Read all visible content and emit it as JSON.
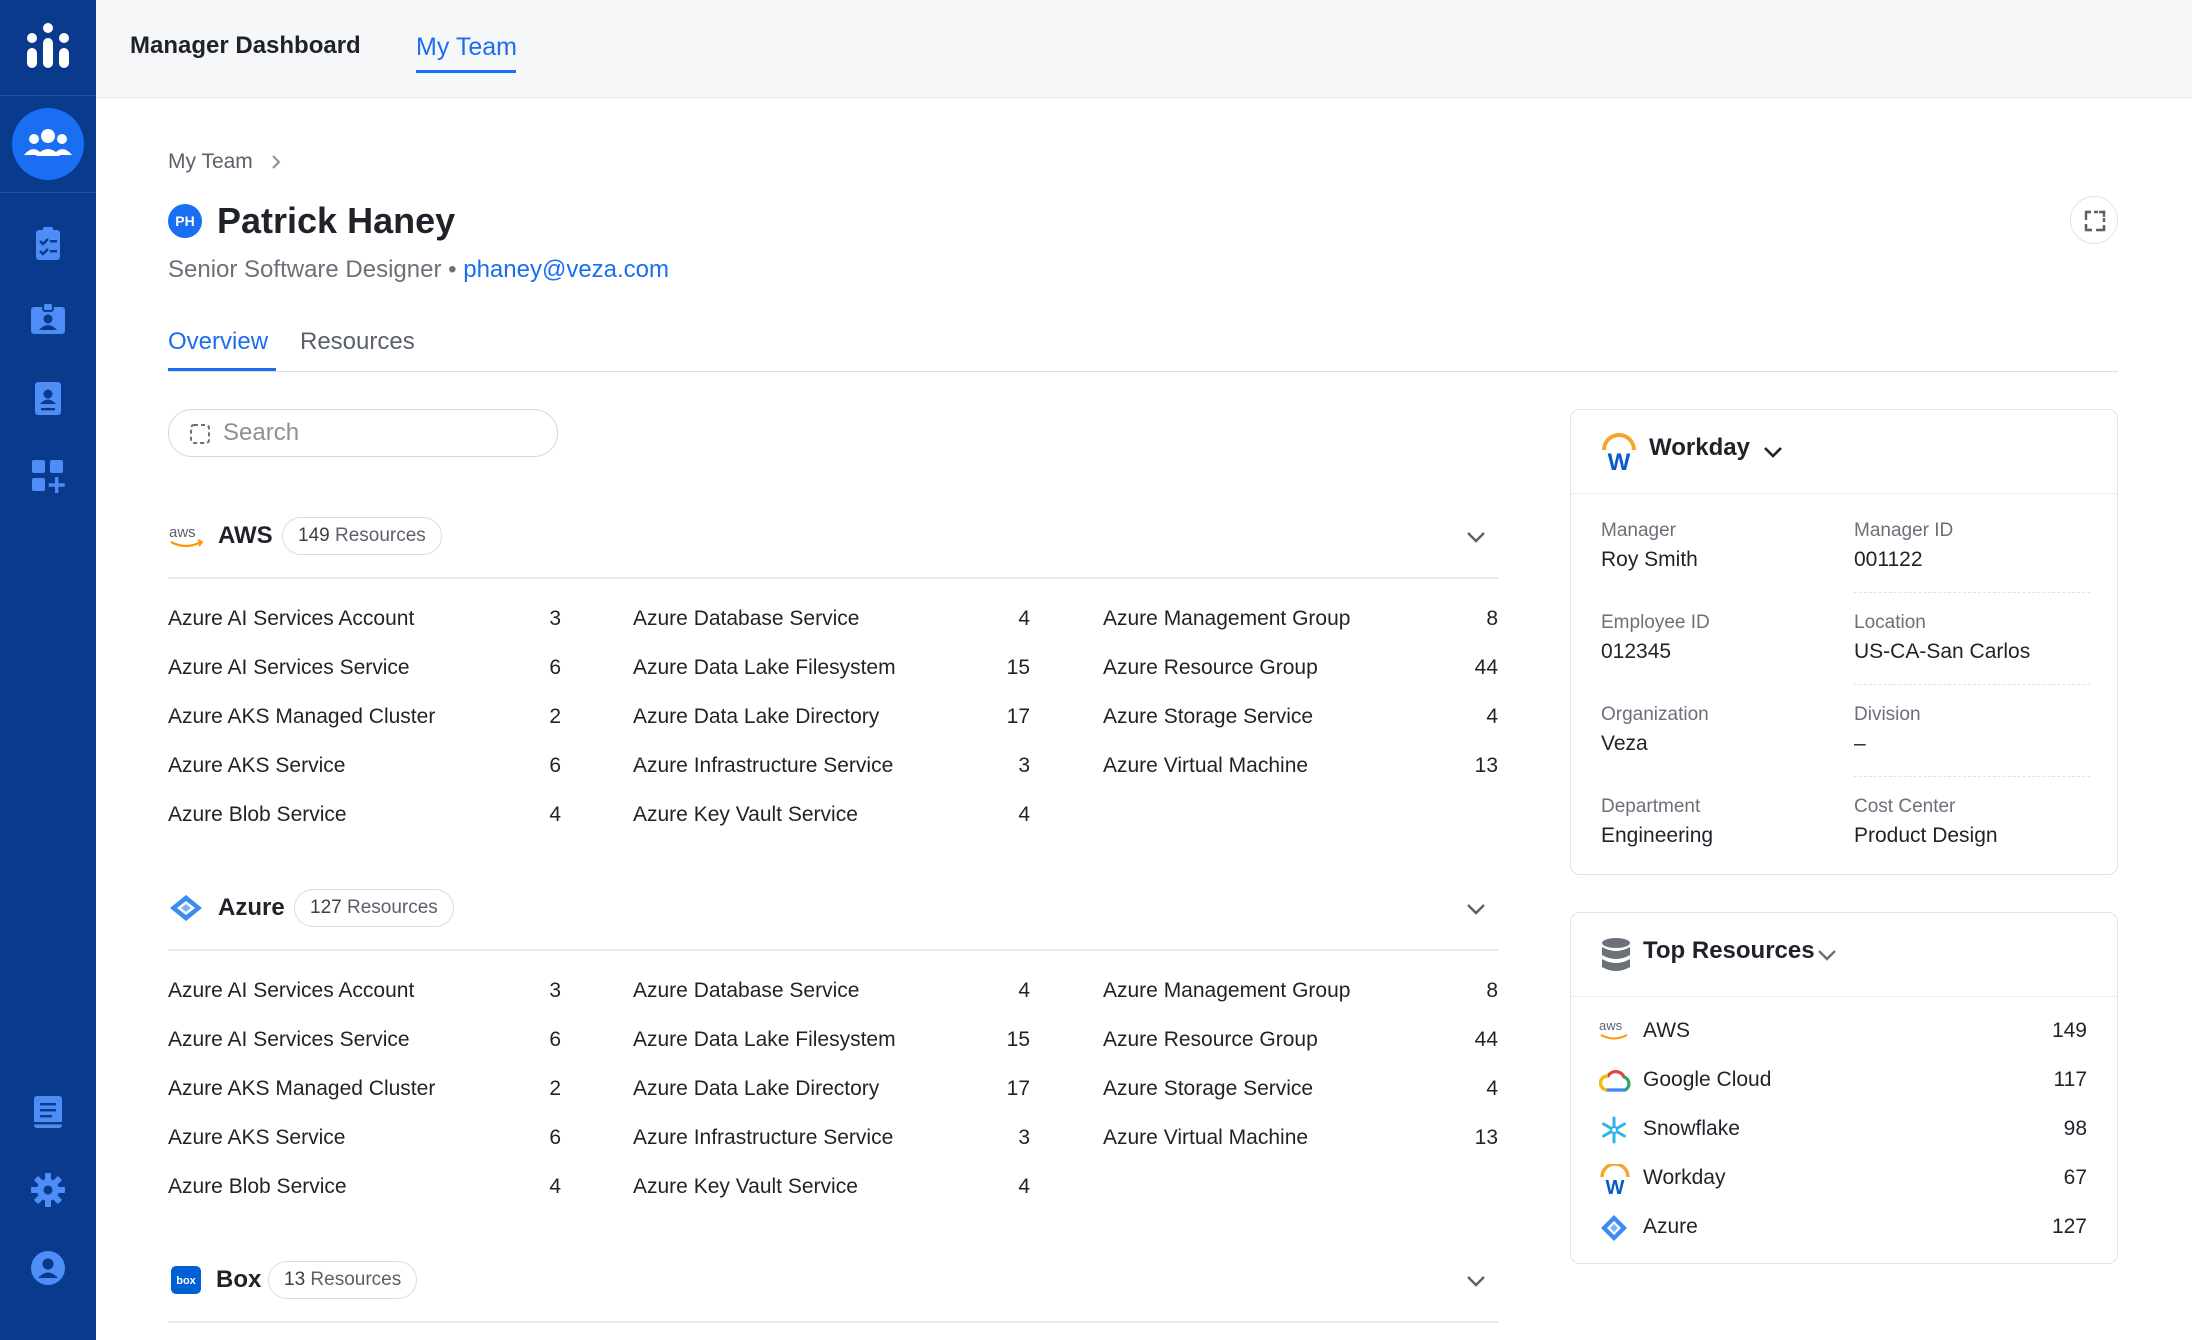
{
  "app": {
    "title": "Manager Dashboard",
    "nav_tab": "My Team"
  },
  "breadcrumb": {
    "item": "My Team"
  },
  "person": {
    "initials": "PH",
    "name": "Patrick Haney",
    "title": "Senior Software Designer",
    "separator": "•",
    "email": "phaney@veza.com"
  },
  "tabs": {
    "overview": "Overview",
    "resources": "Resources"
  },
  "search": {
    "placeholder": "Search"
  },
  "groups": {
    "aws": {
      "logo": "aws-logo",
      "name": "AWS",
      "count": "149",
      "unit": "Resources",
      "items": [
        {
          "name": "Azure AI Services Account",
          "value": "3"
        },
        {
          "name": "Azure AI Services Service",
          "value": "6"
        },
        {
          "name": "Azure AKS Managed Cluster",
          "value": "2"
        },
        {
          "name": "Azure AKS Service",
          "value": "6"
        },
        {
          "name": "Azure Blob Service",
          "value": "4"
        },
        {
          "name": "Azure Database Service",
          "value": "4"
        },
        {
          "name": "Azure Data Lake Filesystem",
          "value": "15"
        },
        {
          "name": "Azure Data Lake Directory",
          "value": "17"
        },
        {
          "name": "Azure Infrastructure Service",
          "value": "3"
        },
        {
          "name": "Azure Key Vault Service",
          "value": "4"
        },
        {
          "name": "Azure Management Group",
          "value": "8"
        },
        {
          "name": "Azure Resource Group",
          "value": "44"
        },
        {
          "name": "Azure Storage Service",
          "value": "4"
        },
        {
          "name": "Azure Virtual Machine",
          "value": "13"
        }
      ]
    },
    "azure": {
      "logo": "azure-logo",
      "name": "Azure",
      "count": "127",
      "unit": "Resources",
      "items": [
        {
          "name": "Azure AI Services Account",
          "value": "3"
        },
        {
          "name": "Azure AI Services Service",
          "value": "6"
        },
        {
          "name": "Azure AKS Managed Cluster",
          "value": "2"
        },
        {
          "name": "Azure AKS Service",
          "value": "6"
        },
        {
          "name": "Azure Blob Service",
          "value": "4"
        },
        {
          "name": "Azure Database Service",
          "value": "4"
        },
        {
          "name": "Azure Data Lake Filesystem",
          "value": "15"
        },
        {
          "name": "Azure Data Lake Directory",
          "value": "17"
        },
        {
          "name": "Azure Infrastructure Service",
          "value": "3"
        },
        {
          "name": "Azure Key Vault Service",
          "value": "4"
        },
        {
          "name": "Azure Management Group",
          "value": "8"
        },
        {
          "name": "Azure Resource Group",
          "value": "44"
        },
        {
          "name": "Azure Storage Service",
          "value": "4"
        },
        {
          "name": "Azure Virtual Machine",
          "value": "13"
        }
      ]
    },
    "box": {
      "logo": "box-logo",
      "logo_text": "box",
      "name": "Box",
      "count": "13",
      "unit": "Resources"
    }
  },
  "workday_card": {
    "logo": "workday-logo",
    "logo_text": "W",
    "title": "Workday",
    "fields": [
      {
        "label": "Manager",
        "value": "Roy Smith"
      },
      {
        "label": "Manager ID",
        "value": "001122"
      },
      {
        "label": "Employee ID",
        "value": "012345"
      },
      {
        "label": "Location",
        "value": "US-CA-San Carlos"
      },
      {
        "label": "Organization",
        "value": "Veza"
      },
      {
        "label": "Division",
        "value": "–"
      },
      {
        "label": "Department",
        "value": "Engineering"
      },
      {
        "label": "Cost Center",
        "value": "Product Design"
      }
    ]
  },
  "top_resources": {
    "title": "Top Resources",
    "items": [
      {
        "icon": "aws-logo",
        "name": "AWS",
        "value": "149"
      },
      {
        "icon": "google-cloud-logo",
        "name": "Google Cloud",
        "value": "117"
      },
      {
        "icon": "snowflake-logo",
        "name": "Snowflake",
        "value": "98"
      },
      {
        "icon": "workday-logo",
        "name": "Workday",
        "value": "67",
        "icon_text": "W"
      },
      {
        "icon": "azure-logo",
        "name": "Azure",
        "value": "127"
      }
    ]
  },
  "colors": {
    "rail": "#0a3a8c",
    "accent": "#1a6ef2",
    "aws_orange": "#ff9900",
    "workday_orange": "#f4a62a",
    "workday_blue": "#0a5ac9",
    "snowflake": "#29b5e8",
    "box_blue": "#0061d5"
  },
  "rail_icons": [
    "veza-logo",
    "team-icon",
    "clipboard-check-icon",
    "id-badge-icon",
    "contact-card-icon",
    "apps-add-icon",
    "book-icon",
    "gear-icon",
    "user-icon"
  ]
}
